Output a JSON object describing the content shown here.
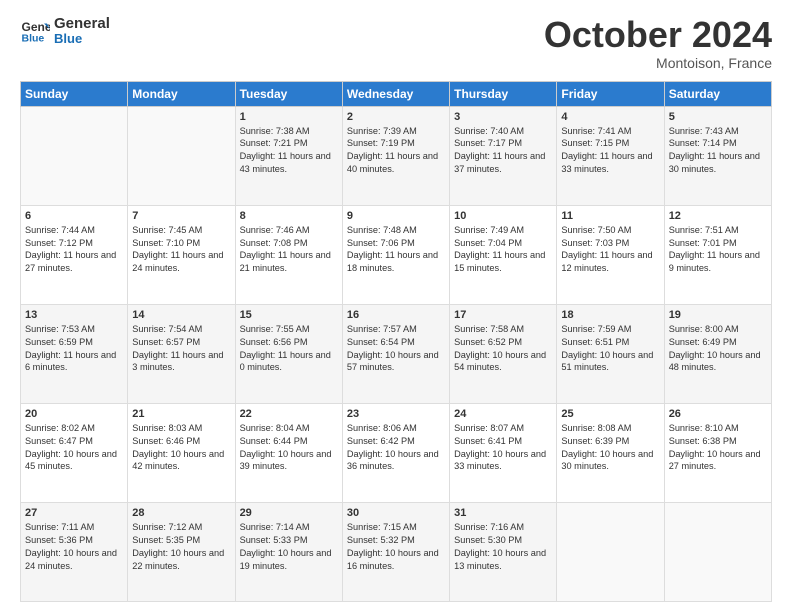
{
  "header": {
    "logo_line1": "General",
    "logo_line2": "Blue",
    "month_year": "October 2024",
    "location": "Montoison, France"
  },
  "weekdays": [
    "Sunday",
    "Monday",
    "Tuesday",
    "Wednesday",
    "Thursday",
    "Friday",
    "Saturday"
  ],
  "weeks": [
    [
      {
        "day": "",
        "info": ""
      },
      {
        "day": "",
        "info": ""
      },
      {
        "day": "1",
        "info": "Sunrise: 7:38 AM\nSunset: 7:21 PM\nDaylight: 11 hours and 43 minutes."
      },
      {
        "day": "2",
        "info": "Sunrise: 7:39 AM\nSunset: 7:19 PM\nDaylight: 11 hours and 40 minutes."
      },
      {
        "day": "3",
        "info": "Sunrise: 7:40 AM\nSunset: 7:17 PM\nDaylight: 11 hours and 37 minutes."
      },
      {
        "day": "4",
        "info": "Sunrise: 7:41 AM\nSunset: 7:15 PM\nDaylight: 11 hours and 33 minutes."
      },
      {
        "day": "5",
        "info": "Sunrise: 7:43 AM\nSunset: 7:14 PM\nDaylight: 11 hours and 30 minutes."
      }
    ],
    [
      {
        "day": "6",
        "info": "Sunrise: 7:44 AM\nSunset: 7:12 PM\nDaylight: 11 hours and 27 minutes."
      },
      {
        "day": "7",
        "info": "Sunrise: 7:45 AM\nSunset: 7:10 PM\nDaylight: 11 hours and 24 minutes."
      },
      {
        "day": "8",
        "info": "Sunrise: 7:46 AM\nSunset: 7:08 PM\nDaylight: 11 hours and 21 minutes."
      },
      {
        "day": "9",
        "info": "Sunrise: 7:48 AM\nSunset: 7:06 PM\nDaylight: 11 hours and 18 minutes."
      },
      {
        "day": "10",
        "info": "Sunrise: 7:49 AM\nSunset: 7:04 PM\nDaylight: 11 hours and 15 minutes."
      },
      {
        "day": "11",
        "info": "Sunrise: 7:50 AM\nSunset: 7:03 PM\nDaylight: 11 hours and 12 minutes."
      },
      {
        "day": "12",
        "info": "Sunrise: 7:51 AM\nSunset: 7:01 PM\nDaylight: 11 hours and 9 minutes."
      }
    ],
    [
      {
        "day": "13",
        "info": "Sunrise: 7:53 AM\nSunset: 6:59 PM\nDaylight: 11 hours and 6 minutes."
      },
      {
        "day": "14",
        "info": "Sunrise: 7:54 AM\nSunset: 6:57 PM\nDaylight: 11 hours and 3 minutes."
      },
      {
        "day": "15",
        "info": "Sunrise: 7:55 AM\nSunset: 6:56 PM\nDaylight: 11 hours and 0 minutes."
      },
      {
        "day": "16",
        "info": "Sunrise: 7:57 AM\nSunset: 6:54 PM\nDaylight: 10 hours and 57 minutes."
      },
      {
        "day": "17",
        "info": "Sunrise: 7:58 AM\nSunset: 6:52 PM\nDaylight: 10 hours and 54 minutes."
      },
      {
        "day": "18",
        "info": "Sunrise: 7:59 AM\nSunset: 6:51 PM\nDaylight: 10 hours and 51 minutes."
      },
      {
        "day": "19",
        "info": "Sunrise: 8:00 AM\nSunset: 6:49 PM\nDaylight: 10 hours and 48 minutes."
      }
    ],
    [
      {
        "day": "20",
        "info": "Sunrise: 8:02 AM\nSunset: 6:47 PM\nDaylight: 10 hours and 45 minutes."
      },
      {
        "day": "21",
        "info": "Sunrise: 8:03 AM\nSunset: 6:46 PM\nDaylight: 10 hours and 42 minutes."
      },
      {
        "day": "22",
        "info": "Sunrise: 8:04 AM\nSunset: 6:44 PM\nDaylight: 10 hours and 39 minutes."
      },
      {
        "day": "23",
        "info": "Sunrise: 8:06 AM\nSunset: 6:42 PM\nDaylight: 10 hours and 36 minutes."
      },
      {
        "day": "24",
        "info": "Sunrise: 8:07 AM\nSunset: 6:41 PM\nDaylight: 10 hours and 33 minutes."
      },
      {
        "day": "25",
        "info": "Sunrise: 8:08 AM\nSunset: 6:39 PM\nDaylight: 10 hours and 30 minutes."
      },
      {
        "day": "26",
        "info": "Sunrise: 8:10 AM\nSunset: 6:38 PM\nDaylight: 10 hours and 27 minutes."
      }
    ],
    [
      {
        "day": "27",
        "info": "Sunrise: 7:11 AM\nSunset: 5:36 PM\nDaylight: 10 hours and 24 minutes."
      },
      {
        "day": "28",
        "info": "Sunrise: 7:12 AM\nSunset: 5:35 PM\nDaylight: 10 hours and 22 minutes."
      },
      {
        "day": "29",
        "info": "Sunrise: 7:14 AM\nSunset: 5:33 PM\nDaylight: 10 hours and 19 minutes."
      },
      {
        "day": "30",
        "info": "Sunrise: 7:15 AM\nSunset: 5:32 PM\nDaylight: 10 hours and 16 minutes."
      },
      {
        "day": "31",
        "info": "Sunrise: 7:16 AM\nSunset: 5:30 PM\nDaylight: 10 hours and 13 minutes."
      },
      {
        "day": "",
        "info": ""
      },
      {
        "day": "",
        "info": ""
      }
    ]
  ]
}
